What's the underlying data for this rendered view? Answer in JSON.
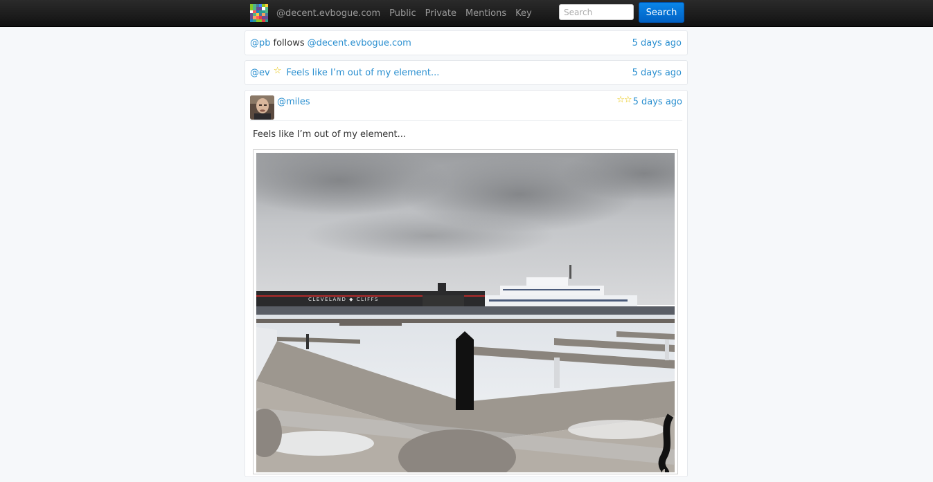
{
  "nav": {
    "site": "@decent.evbogue.com",
    "links": [
      "Public",
      "Private",
      "Mentions",
      "Key"
    ],
    "search_placeholder": "Search",
    "search_button": "Search"
  },
  "feed": [
    {
      "type": "follow",
      "actor": "@pb",
      "verb": "follows",
      "target": "@decent.evbogue.com",
      "time": "5 days ago"
    },
    {
      "type": "star",
      "actor": "@ev",
      "star": "☆",
      "text": "Feels like I’m out of my element...",
      "time": "5 days ago"
    }
  ],
  "post": {
    "author": "@miles",
    "stars": "☆☆",
    "time": "5 days ago",
    "text": "Feels like I’m out of my element...",
    "photo_sign": "CLEVELAND ◆ CLIFFS"
  },
  "colors": {
    "link": "#2a8fd0",
    "star": "#e6c200",
    "navbar": "#1b1b1b",
    "search_button": "#0a7ae0"
  },
  "icons": {
    "logo": "pixel-mosaic-logo-icon",
    "star": "star-outline-icon"
  }
}
